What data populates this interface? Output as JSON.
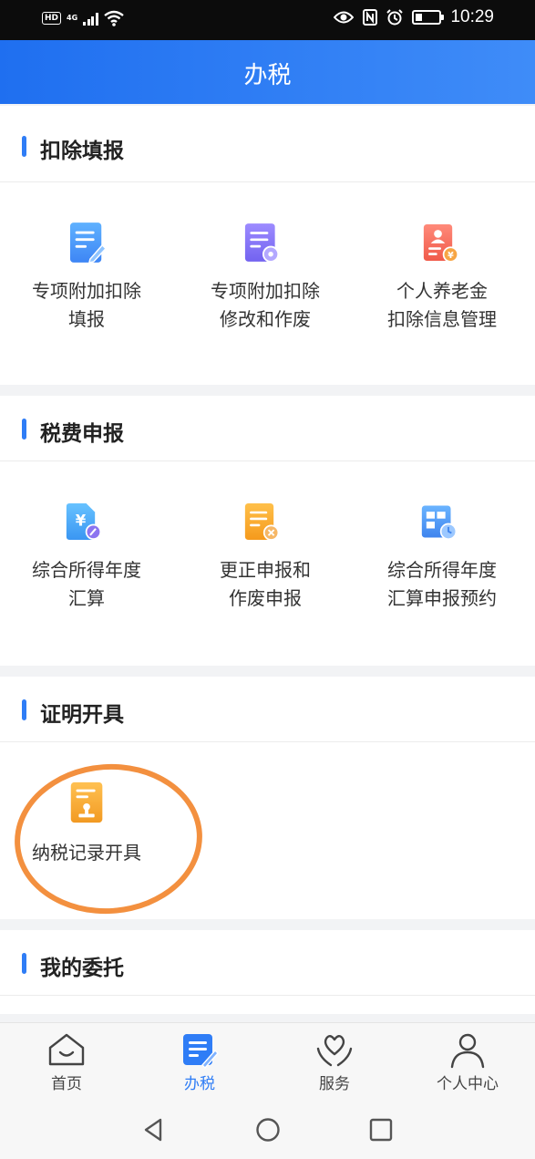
{
  "status_bar": {
    "hd": "HD",
    "network": "4G",
    "time": "10:29"
  },
  "header": {
    "title": "办税"
  },
  "sections": [
    {
      "title": "扣除填报",
      "items": [
        {
          "line1": "专项附加扣除",
          "line2": "填报",
          "icon": "document-edit-icon"
        },
        {
          "line1": "专项附加扣除",
          "line2": "修改和作废",
          "icon": "document-settings-icon"
        },
        {
          "line1": "个人养老金",
          "line2": "扣除信息管理",
          "icon": "pension-id-card-icon"
        }
      ]
    },
    {
      "title": "税费申报",
      "items": [
        {
          "line1": "综合所得年度",
          "line2": "汇算",
          "icon": "yuan-document-icon"
        },
        {
          "line1": "更正申报和",
          "line2": "作废申报",
          "icon": "document-cancel-icon"
        },
        {
          "line1": "综合所得年度",
          "line2": "汇算申报预约",
          "icon": "calendar-clock-icon"
        }
      ]
    },
    {
      "title": "证明开具",
      "items": [
        {
          "line1": "纳税记录开具",
          "icon": "stamp-document-icon"
        }
      ]
    },
    {
      "title": "我的委托",
      "items": []
    }
  ],
  "tabs": [
    {
      "label": "首页",
      "icon": "home-icon",
      "active": false
    },
    {
      "label": "办税",
      "icon": "tax-document-icon",
      "active": true
    },
    {
      "label": "服务",
      "icon": "heart-hands-icon",
      "active": false
    },
    {
      "label": "个人中心",
      "icon": "person-icon",
      "active": false
    }
  ],
  "colors": {
    "accent": "#2f7df6",
    "highlight": "#f3903f"
  }
}
